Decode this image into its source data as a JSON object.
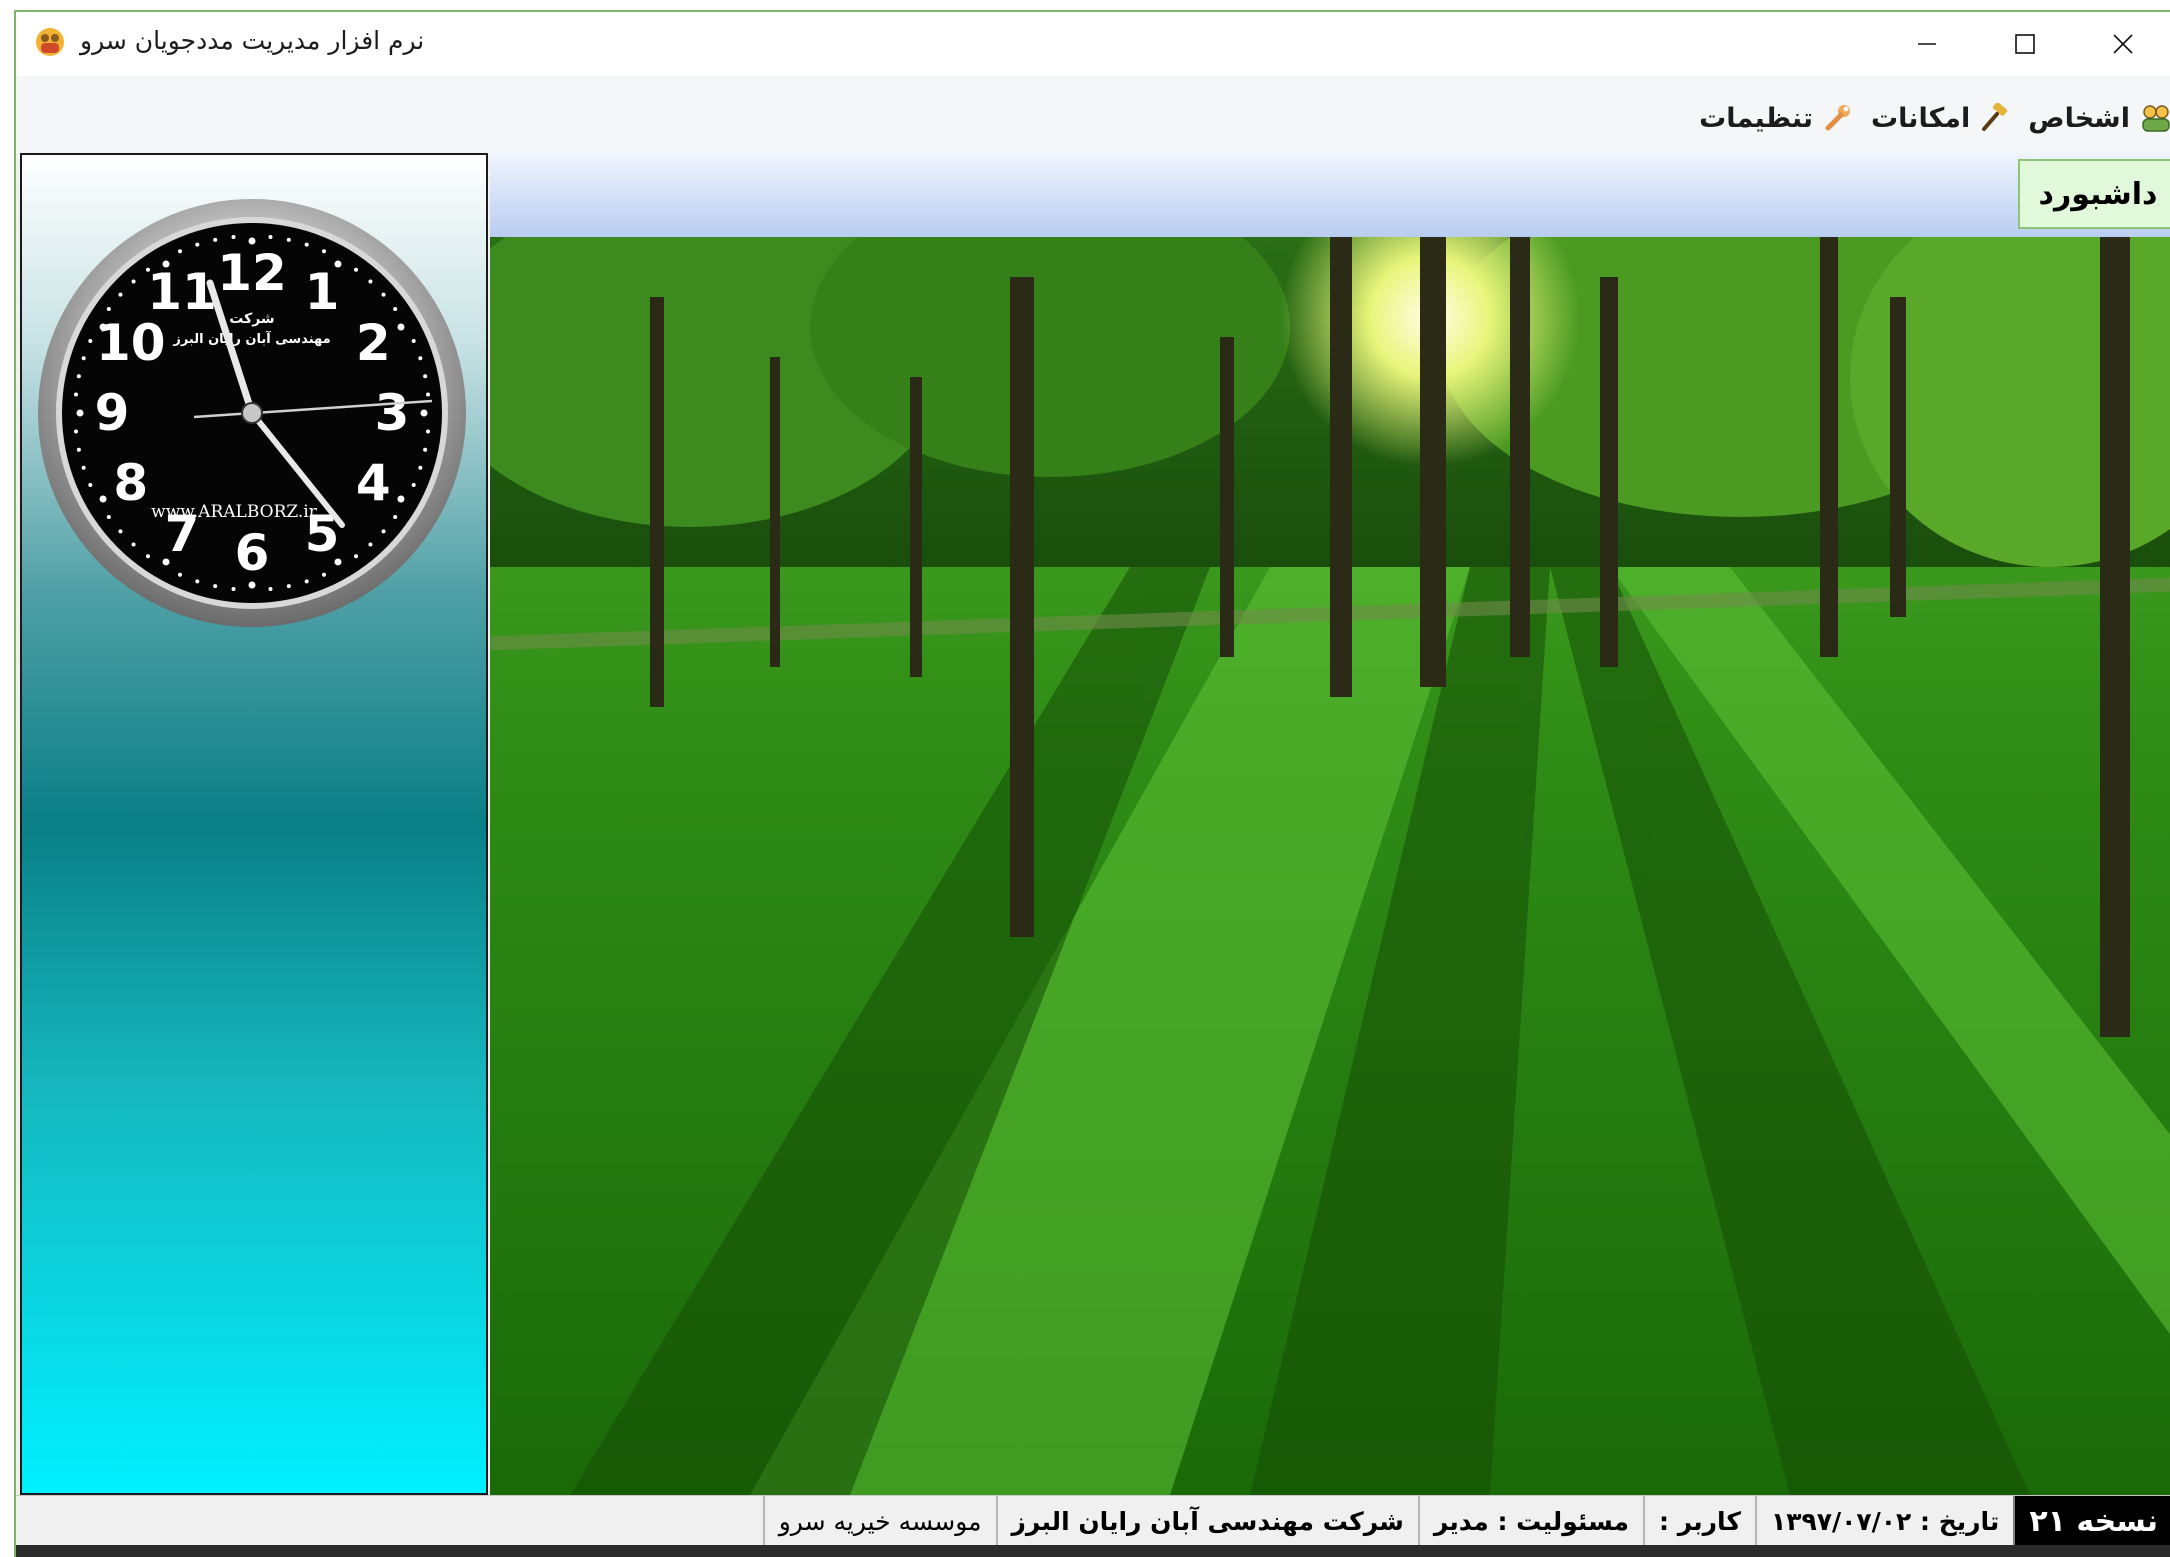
{
  "window": {
    "title": "نرم افزار مدیریت مددجویان سرو",
    "controls": {
      "minimize": "—",
      "maximize": "☐",
      "close": "✕"
    }
  },
  "menu": {
    "items": [
      {
        "label": "اشخاص",
        "icon": "people-icon"
      },
      {
        "label": "امکانات",
        "icon": "hammer-icon"
      },
      {
        "label": "تنظیمات",
        "icon": "wrench-icon"
      }
    ]
  },
  "tab": {
    "dashboard_label": "داشبورد"
  },
  "clock": {
    "company_line1": "شرکت",
    "company_line2": "مهندسی آبان رایان البرز",
    "website": "www.ARALBORZ.ir",
    "numerals": [
      "12",
      "1",
      "2",
      "3",
      "4",
      "5",
      "6",
      "7",
      "8",
      "9",
      "10",
      "11"
    ]
  },
  "status": {
    "version": "نسخه ۲۱",
    "date_label": "تاریخ :",
    "date_value": "۱۳۹۷/۰۷/۰۲",
    "user_label": "کاربر :",
    "role_label": "مسئولیت :",
    "role_value": "مدیر",
    "company": "شرکت مهندسی آبان رایان البرز",
    "org": "موسسه خیریه سرو"
  },
  "colors": {
    "accent": "#8bc474",
    "tab_bg": "#e2f8da",
    "header_strip": "#b9cdf0"
  }
}
